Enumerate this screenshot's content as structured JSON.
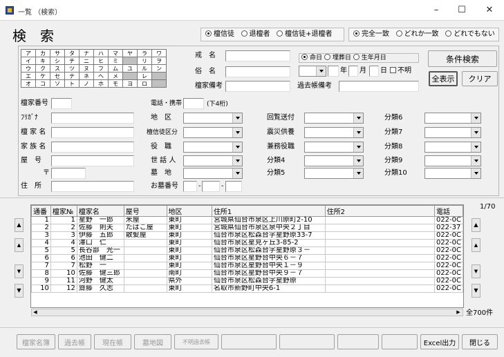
{
  "window": {
    "title": "一覧 （検索）"
  },
  "header": {
    "title": "検　索"
  },
  "status_radios": [
    {
      "label": "檀信徒",
      "on": true
    },
    {
      "label": "退檀者",
      "on": false
    },
    {
      "label": "檀信徒+退檀者",
      "on": false
    }
  ],
  "match_radios": [
    {
      "label": "完全一致",
      "on": true
    },
    {
      "label": "どれか一致",
      "on": false
    },
    {
      "label": "どれでもない",
      "on": false
    }
  ],
  "kana_grid": [
    [
      "ア",
      "カ",
      "サ",
      "タ",
      "ナ",
      "ハ",
      "マ",
      "ヤ",
      "ラ",
      "ワ"
    ],
    [
      "イ",
      "キ",
      "シ",
      "チ",
      "ニ",
      "ヒ",
      "ミ",
      "",
      "リ",
      "ヲ"
    ],
    [
      "ウ",
      "ク",
      "ス",
      "ツ",
      "ヌ",
      "フ",
      "ム",
      "ユ",
      "ル",
      "ン"
    ],
    [
      "エ",
      "ケ",
      "セ",
      "テ",
      "ネ",
      "ヘ",
      "メ",
      "",
      "レ",
      ""
    ],
    [
      "オ",
      "コ",
      "ソ",
      "ト",
      "ノ",
      "ホ",
      "モ",
      "ヨ",
      "ロ",
      ""
    ]
  ],
  "form": {
    "kaimyo": "戒　名",
    "zokumyo": "俗　名",
    "danka_biko": "檀家備考",
    "kakochou_biko": "過去帳備考",
    "date_radios": [
      {
        "label": "命日",
        "on": true
      },
      {
        "label": "埋葬日",
        "on": false
      },
      {
        "label": "生年月日",
        "on": false
      }
    ],
    "year": "年",
    "month": "月",
    "day": "日",
    "unknown": "不明",
    "danka_no": "檀家番号",
    "tel": "電話・携帯",
    "tel_hint": "(下4桁)",
    "furigana": "ﾌﾘｶﾞﾅ",
    "danka_name": "檀 家 名",
    "kazoku_name": "家 族 名",
    "yago": "屋　号",
    "postal": "〒",
    "address": "住　所",
    "chiku": "地　区",
    "danshinto_kubun": "檀信徒区分",
    "yakushoku": "役　職",
    "sewanin": "世 話 人",
    "bochi": "墓　地",
    "ohaka_no": "お墓番号",
    "kairan": "回覧送付",
    "shinsai": "震災供養",
    "kenmu": "兼務役職",
    "bunrui4": "分類4",
    "bunrui5": "分類5",
    "bunrui6": "分類6",
    "bunrui7": "分類7",
    "bunrui8": "分類8",
    "bunrui9": "分類9",
    "bunrui10": "分類10"
  },
  "buttons": {
    "search": "条件検索",
    "show_all": "全表示",
    "clear": "クリア"
  },
  "grid": {
    "page": "1/70",
    "total": "全700件",
    "columns": [
      "通番",
      "檀家№",
      "檀家名",
      "屋号",
      "地区",
      "住所1",
      "住所2",
      "電話"
    ],
    "rows": [
      [
        "1",
        "1",
        "星野　一郎",
        "米屋",
        "東町",
        "宮城県仙台市泉区上川原町2-10",
        "",
        "022-0C"
      ],
      [
        "2",
        "2",
        "佐藤　則夫",
        "たばこ屋",
        "東町",
        "宮城県仙台市泉区泉中央２丁目",
        "",
        "022-37"
      ],
      [
        "3",
        "3",
        "伊藤　五郎",
        "散髪屋",
        "東町",
        "仙台市泉区松森台字星野原33-7",
        "",
        "022-0C"
      ],
      [
        "4",
        "4",
        "澤口　仁",
        "",
        "東町",
        "仙台市泉区星見ヶ丘3-85-2",
        "",
        "022-0C"
      ],
      [
        "5",
        "5",
        "長谷部　光一",
        "",
        "東町",
        "仙台市泉区松森台字星野原３－",
        "",
        "022-0C"
      ],
      [
        "6",
        "6",
        "池田　健二",
        "",
        "東町",
        "仙台市泉区星野台中央６－７",
        "",
        "022-0C"
      ],
      [
        "7",
        "7",
        "松野　一",
        "",
        "東町",
        "仙台市泉区星野台中央１－９",
        "",
        "022-0C"
      ],
      [
        "8",
        "10",
        "佐藤　健三郎",
        "",
        "南町",
        "仙台市泉区星野台中央９－７",
        "",
        "022-0C"
      ],
      [
        "9",
        "11",
        "河野　健太",
        "",
        "県外",
        "仙台市泉区松森台字星野原",
        "",
        "022-0C"
      ],
      [
        "10",
        "12",
        "齋藤　久志",
        "",
        "東町",
        "名取市新野町中央6-1",
        "",
        "022-0C"
      ]
    ]
  },
  "bottom": {
    "danka_meibo": "檀家名簿",
    "kakochou": "過去帳",
    "genzaichou": "現在帳",
    "bochizu": "墓地図",
    "fumei_kakochou": "不明過去帳",
    "excel": "Excel出力",
    "close": "閉じる"
  }
}
